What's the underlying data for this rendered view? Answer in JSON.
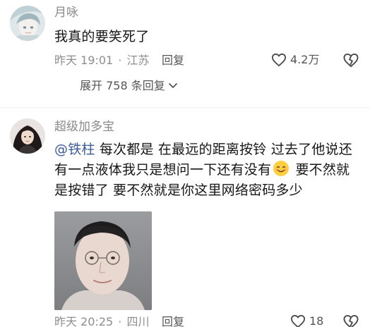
{
  "comments": [
    {
      "username": "月咏",
      "text": "我真的要笑死了",
      "time": "昨天 19:01",
      "location": "江苏",
      "separator": "·",
      "reply_label": "回复",
      "likes": "4.2万",
      "expand_label": "展开 758 条回复"
    },
    {
      "username": "超级加多宝",
      "mention": "@铁柱",
      "text_part1": " 每次都是 在最远的距离按铃 过去了他说还有一点液体我只是想问一下还有没有",
      "text_part2": " 要不然就是按错了 要不然就是你这里网络密码多少",
      "time": "昨天 20:25",
      "location": "四川",
      "separator": "·",
      "reply_label": "回复",
      "likes": "18"
    }
  ],
  "icons": {
    "like": "heart-outline-icon",
    "dislike": "broken-heart-icon",
    "expand": "chevron-down-icon",
    "emoji": "smiling-face-emoji"
  },
  "colors": {
    "mention": "#3a5a99",
    "meta_text": "#8d8d8d",
    "body_text": "#161616"
  }
}
